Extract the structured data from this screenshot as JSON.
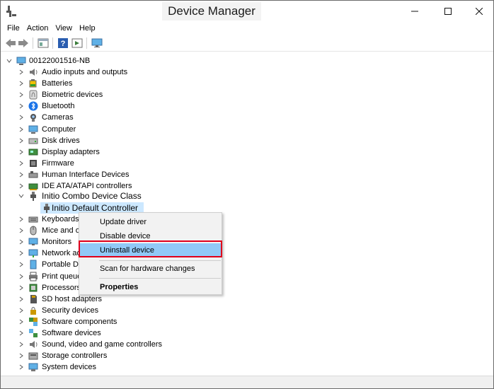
{
  "window": {
    "title": "Device Manager"
  },
  "menu": [
    "File",
    "Action",
    "View",
    "Help"
  ],
  "toolbar_icons": [
    "back-icon",
    "forward-icon",
    "properties-icon",
    "help-icon",
    "update-driver-icon",
    "monitor-icon"
  ],
  "tree": {
    "root_label": "00122001516-NB",
    "categories": [
      {
        "label": "Audio inputs and outputs",
        "icon": "speaker-icon"
      },
      {
        "label": "Batteries",
        "icon": "battery-icon"
      },
      {
        "label": "Biometric devices",
        "icon": "fingerprint-icon"
      },
      {
        "label": "Bluetooth",
        "icon": "bluetooth-icon"
      },
      {
        "label": "Cameras",
        "icon": "camera-icon"
      },
      {
        "label": "Computer",
        "icon": "computer-icon"
      },
      {
        "label": "Disk drives",
        "icon": "disk-icon"
      },
      {
        "label": "Display adapters",
        "icon": "display-adapter-icon"
      },
      {
        "label": "Firmware",
        "icon": "firmware-icon"
      },
      {
        "label": "Human Interface Devices",
        "icon": "hid-icon"
      },
      {
        "label": "IDE ATA/ATAPI controllers",
        "icon": "ide-icon"
      }
    ],
    "expanded_category": {
      "label": "Initio Combo Device Class",
      "icon": "usb-plug-icon"
    },
    "selected_child": {
      "label": "Initio Default Controller",
      "icon": "usb-plug-icon"
    },
    "categories_after": [
      {
        "label": "Keyboards",
        "icon": "keyboard-icon"
      },
      {
        "label": "Mice and other pointing devices",
        "icon": "mouse-icon"
      },
      {
        "label": "Monitors",
        "icon": "monitor-icon"
      },
      {
        "label": "Network adapters",
        "icon": "network-icon"
      },
      {
        "label": "Portable Devices",
        "icon": "portable-device-icon"
      },
      {
        "label": "Print queues",
        "icon": "printer-icon"
      },
      {
        "label": "Processors",
        "icon": "processor-icon"
      },
      {
        "label": "SD host adapters",
        "icon": "sd-card-icon"
      },
      {
        "label": "Security devices",
        "icon": "security-icon"
      },
      {
        "label": "Software components",
        "icon": "software-components-icon"
      },
      {
        "label": "Software devices",
        "icon": "software-devices-icon"
      },
      {
        "label": "Sound, video and game controllers",
        "icon": "sound-icon"
      },
      {
        "label": "Storage controllers",
        "icon": "storage-icon"
      },
      {
        "label": "System devices",
        "icon": "system-devices-icon"
      }
    ]
  },
  "context_menu": {
    "items": [
      "Update driver",
      "Disable device",
      "Uninstall device",
      "Scan for hardware changes",
      "Properties"
    ],
    "highlighted": "Uninstall device"
  },
  "colors": {
    "selection": "#cce8ff",
    "menu_highlight": "#91c9f7",
    "annotation_box": "#e0001b"
  }
}
